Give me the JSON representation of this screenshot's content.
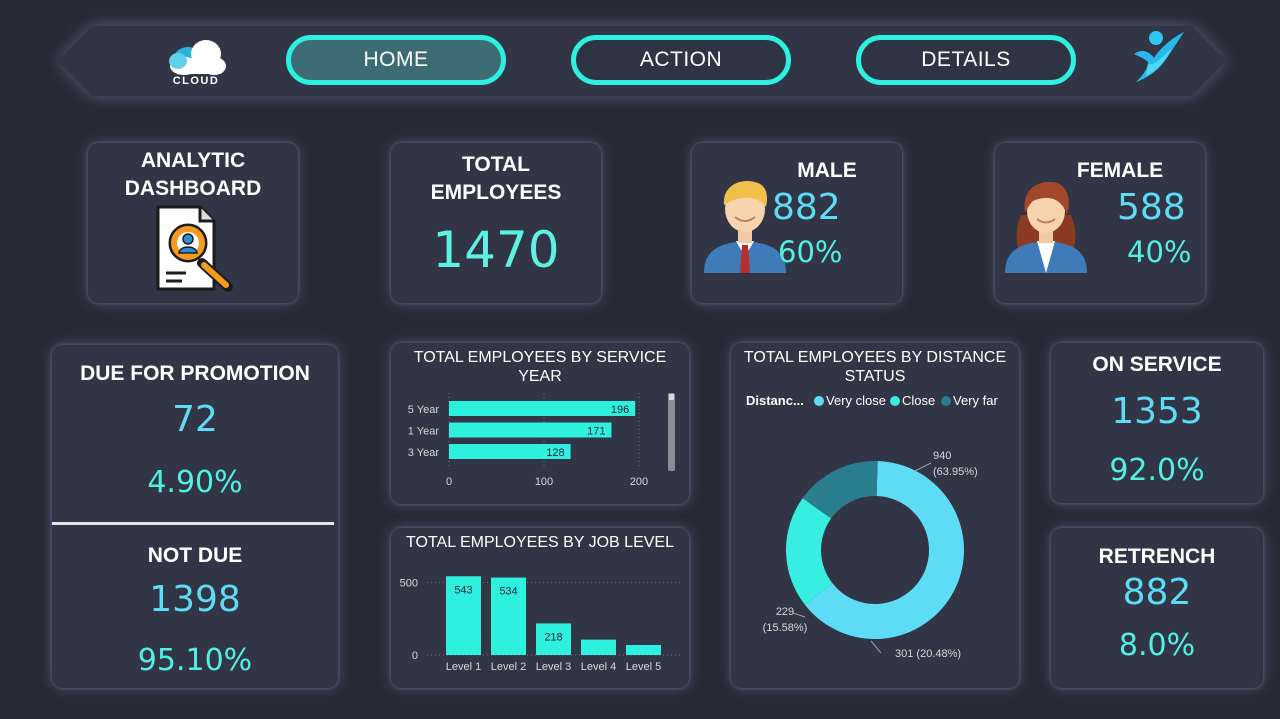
{
  "nav": {
    "logo_text": "CLOUD",
    "buttons": [
      {
        "label": "HOME",
        "active": true
      },
      {
        "label": "ACTION",
        "active": false
      },
      {
        "label": "DETAILS",
        "active": false
      }
    ]
  },
  "kpis": {
    "analytic": {
      "title_line1": "ANALYTIC",
      "title_line2": "DASHBOARD"
    },
    "total": {
      "title_line1": "TOTAL",
      "title_line2": "EMPLOYEES",
      "value": "1470"
    },
    "male": {
      "title": "MALE",
      "value": "882",
      "pct": "60%"
    },
    "female": {
      "title": "FEMALE",
      "value": "588",
      "pct": "40%"
    },
    "promotion": {
      "due_title": "DUE FOR PROMOTION",
      "due_value": "72",
      "due_pct": "4.90%",
      "not_title": "NOT DUE",
      "not_value": "1398",
      "not_pct": "95.10%"
    },
    "on_service": {
      "title": "ON SERVICE",
      "value": "1353",
      "pct": "92.0%"
    },
    "retrench": {
      "title": "RETRENCH",
      "value": "882",
      "pct": "8.0%"
    }
  },
  "colors": {
    "accent": "#2ef0df",
    "number": "#5fdcf5",
    "very_close": "#5fdcf5",
    "close": "#38eee0",
    "very_far": "#2a7d8c",
    "card": "#313545",
    "background": "#262a36"
  },
  "chart_data": [
    {
      "type": "bar",
      "orientation": "horizontal",
      "title_line1": "TOTAL EMPLOYEES BY SERVICE",
      "title_line2": "YEAR",
      "categories": [
        "5 Year",
        "1 Year",
        "3 Year"
      ],
      "values": [
        196,
        171,
        128
      ],
      "xlim": [
        0,
        200
      ],
      "xticks": [
        "0",
        "100",
        "200"
      ],
      "grid": true
    },
    {
      "type": "bar",
      "title": "TOTAL EMPLOYEES BY JOB LEVEL",
      "categories": [
        "Level 1",
        "Level 2",
        "Level 3",
        "Level 4",
        "Level 5"
      ],
      "values": [
        543,
        534,
        218,
        106,
        69
      ],
      "value_labels": [
        "543",
        "534",
        "218",
        "",
        ""
      ],
      "ylim": [
        0,
        600
      ],
      "yticks": [
        "0",
        "500"
      ],
      "grid": true
    },
    {
      "type": "pie",
      "donut": true,
      "title_line1": "TOTAL EMPLOYEES BY DISTANCE",
      "title_line2": "STATUS",
      "legend_title": "Distanc...",
      "legend_position": "top",
      "slices": [
        {
          "label": "Very close",
          "value": 940,
          "pct": "63.95%",
          "line1": "940",
          "line2": "(63.95%)"
        },
        {
          "label": "Close",
          "value": 301,
          "pct": "20.48%",
          "line1": "301 (20.48%)",
          "line2": ""
        },
        {
          "label": "Very far",
          "value": 229,
          "pct": "15.58%",
          "line1": "229",
          "line2": "(15.58%)"
        }
      ]
    }
  ]
}
